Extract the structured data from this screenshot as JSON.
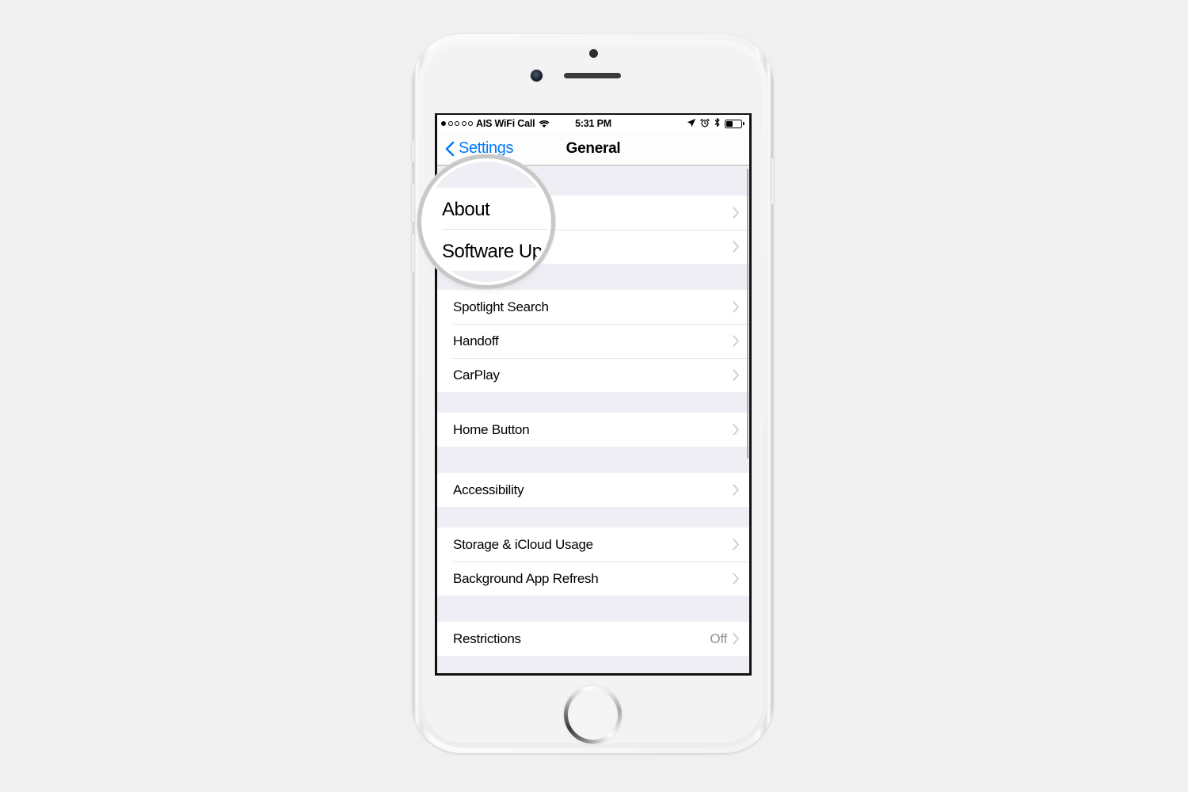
{
  "device": {
    "name": "iPhone",
    "body_color": "#f3f3f3",
    "hardware": {
      "front_camera": "camera-lens",
      "earpiece_speaker": "speaker-grille",
      "proximity_sensor": "proximity-sensor",
      "home_button": "home-button",
      "silent_switch": "silent-switch",
      "volume_up": "volume-up-button",
      "volume_down": "volume-down-button",
      "power": "power-button"
    }
  },
  "status_bar": {
    "signal_dots_total": 5,
    "signal_dots_filled": 1,
    "carrier": "AIS WiFi Call",
    "wifi_icon": "wifi-icon",
    "time": "5:31 PM",
    "icons": [
      "location-arrow-icon",
      "alarm-clock-icon",
      "bluetooth-icon"
    ],
    "battery_percent": 45,
    "battery_icon": "battery-icon"
  },
  "nav_bar": {
    "back_icon": "chevron-left-icon",
    "back_label": "Settings",
    "title": "General"
  },
  "accent_colors": {
    "tint": "#007aff",
    "group_background": "#eeeef4",
    "row_background": "#ffffff",
    "separator": "#e4e4e6",
    "secondary_text": "#8e8e93"
  },
  "list": {
    "chevron_icon": "chevron-right-icon",
    "scroll_indicator": "scroll-indicator",
    "sections": [
      {
        "id": "section-about",
        "rows": [
          {
            "label": "About",
            "value": "",
            "accessory": "chevron-right-icon"
          },
          {
            "label": "Software Update",
            "value": "",
            "accessory": "chevron-right-icon"
          }
        ]
      },
      {
        "id": "section-continuity",
        "rows": [
          {
            "label": "Spotlight Search",
            "value": "",
            "accessory": "chevron-right-icon"
          },
          {
            "label": "Handoff",
            "value": "",
            "accessory": "chevron-right-icon"
          },
          {
            "label": "CarPlay",
            "value": "",
            "accessory": "chevron-right-icon"
          }
        ]
      },
      {
        "id": "section-home-button",
        "rows": [
          {
            "label": "Home Button",
            "value": "",
            "accessory": "chevron-right-icon"
          }
        ]
      },
      {
        "id": "section-accessibility",
        "rows": [
          {
            "label": "Accessibility",
            "value": "",
            "accessory": "chevron-right-icon"
          }
        ]
      },
      {
        "id": "section-storage",
        "rows": [
          {
            "label": "Storage & iCloud Usage",
            "value": "",
            "accessory": "chevron-right-icon"
          },
          {
            "label": "Background App Refresh",
            "value": "",
            "accessory": "chevron-right-icon"
          }
        ]
      },
      {
        "id": "section-restrictions",
        "rows": [
          {
            "label": "Restrictions",
            "value": "Off",
            "accessory": "chevron-right-icon"
          }
        ]
      }
    ]
  },
  "magnifier": {
    "name": "magnifier-loupe",
    "targets": [
      "About",
      "Software Update"
    ],
    "line1": "About",
    "line2": "Software Update",
    "clipped_tail": "te"
  }
}
